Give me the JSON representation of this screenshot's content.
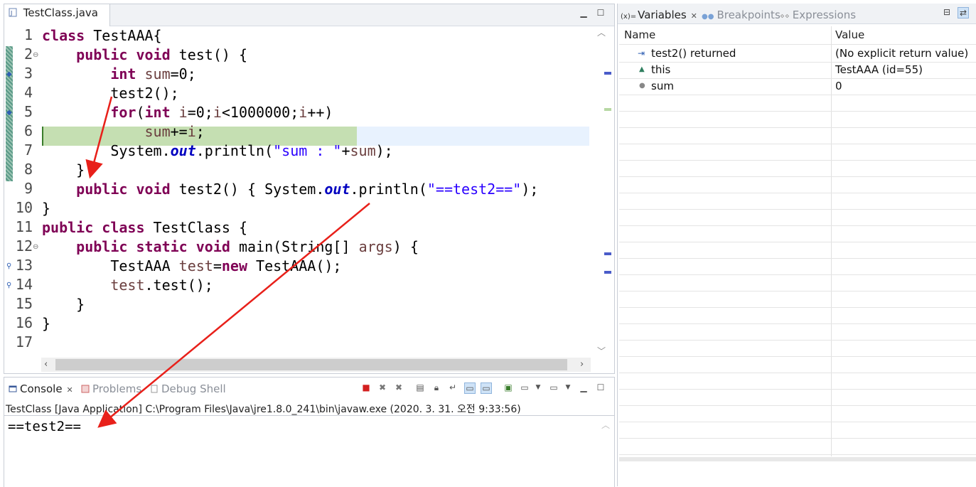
{
  "editor": {
    "tab_title": "TestClass.java",
    "lines": [
      {
        "num": "1"
      },
      {
        "num": "2"
      },
      {
        "num": "3"
      },
      {
        "num": "4"
      },
      {
        "num": "5"
      },
      {
        "num": "6"
      },
      {
        "num": "7"
      },
      {
        "num": "8"
      },
      {
        "num": "9"
      },
      {
        "num": "10"
      },
      {
        "num": "11"
      },
      {
        "num": "12"
      },
      {
        "num": "13"
      },
      {
        "num": "14"
      },
      {
        "num": "15"
      },
      {
        "num": "16"
      },
      {
        "num": "17"
      }
    ],
    "code": {
      "l1_kw": "class",
      "l1_rest": " TestAAA{",
      "l2_kw1": "public",
      "l2_kw2": "void",
      "l2_rest": " test() {",
      "l3_kw": "int",
      "l3_var": " sum",
      "l3_rest": "=0;",
      "l4": "test2();",
      "l5_kw": "for",
      "l5_a": "(",
      "l5_kw2": "int",
      "l5_var1": " i",
      "l5_b": "=0;",
      "l5_var2": "i",
      "l5_c": "<1000000;",
      "l5_var3": "i",
      "l5_d": "++)",
      "l6_var1": "sum",
      "l6_a": "+=",
      "l6_var2": "i",
      "l6_b": ";",
      "l7_a": "System.",
      "l7_fld": "out",
      "l7_b": ".println(",
      "l7_str": "\"sum : \"",
      "l7_c": "+",
      "l7_var": "sum",
      "l7_d": ");",
      "l8": "}",
      "l9_kw1": "public",
      "l9_kw2": "void",
      "l9_a": " test2() { System.",
      "l9_fld": "out",
      "l9_b": ".println(",
      "l9_str": "\"==test2==\"",
      "l9_c": ");",
      "l10": "}",
      "l11_kw1": "public",
      "l11_kw2": "class",
      "l11_rest": " TestClass {",
      "l12_kw1": "public",
      "l12_kw2": "static",
      "l12_kw3": "void",
      "l12_a": " main(String[] ",
      "l12_var": "args",
      "l12_b": ") {",
      "l13_a": "TestAAA ",
      "l13_var": "test",
      "l13_b": "=",
      "l13_kw": "new",
      "l13_c": " TestAAA();",
      "l14_var": "test",
      "l14_a": ".test();",
      "l15": "}",
      "l16": "}"
    }
  },
  "console": {
    "tabs": [
      {
        "label": "Console"
      },
      {
        "label": "Problems"
      },
      {
        "label": "Debug Shell"
      }
    ],
    "header": "TestClass [Java Application] C:\\Program Files\\Java\\jre1.8.0_241\\bin\\javaw.exe (2020. 3. 31. 오전 9:33:56)",
    "output": "==test2=="
  },
  "variables": {
    "tabs": [
      {
        "label": "Variables"
      },
      {
        "label": "Breakpoints"
      },
      {
        "label": "Expressions"
      }
    ],
    "tab_prefix": "(x)=",
    "columns": {
      "name": "Name",
      "value": "Value"
    },
    "rows": [
      {
        "name": "test2() returned",
        "value": "(No explicit return value)",
        "icon": "return-icon"
      },
      {
        "name": "this",
        "value": "TestAAA  (id=55)",
        "icon": "field-triangle-icon"
      },
      {
        "name": "sum",
        "value": "0",
        "icon": "local-var-icon"
      }
    ]
  },
  "colors": {
    "keyword": "#7f0055",
    "string": "#2a00ff",
    "static_field": "#0000c0",
    "local_var": "#6a3e3e",
    "current_line": "#c5dfb2",
    "annotation_arrow": "#e8201a"
  }
}
